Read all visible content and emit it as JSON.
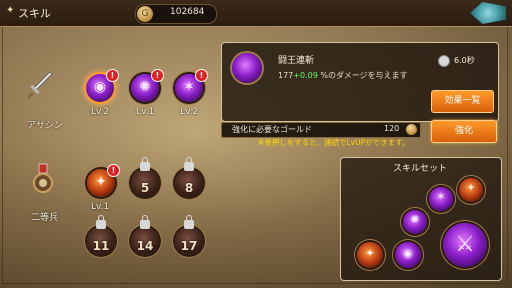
{
  "header": {
    "title": "スキル",
    "gold": "102684"
  },
  "classes": [
    {
      "label": "アサシン",
      "skills": [
        {
          "level": "Lv.2",
          "badge": "!",
          "selected": true,
          "type": "purple",
          "glyph": "◉"
        },
        {
          "level": "Lv.1",
          "badge": "!",
          "selected": false,
          "type": "purple",
          "glyph": "✺"
        },
        {
          "level": "Lv.2",
          "badge": "!",
          "selected": false,
          "type": "purple",
          "glyph": "✶"
        }
      ]
    },
    {
      "label": "二等兵",
      "skills": [
        {
          "level": "Lv.1",
          "badge": "!",
          "type": "fire",
          "glyph": "✦"
        },
        {
          "unlock": "5"
        },
        {
          "unlock": "8"
        },
        {
          "unlock": "11"
        },
        {
          "unlock": "14"
        },
        {
          "unlock": "17"
        }
      ]
    }
  ],
  "detail": {
    "name": "闘王連斬",
    "desc_base": "177",
    "desc_bonus": "+0.09",
    "desc_text": "%のダメージを与えます",
    "cooldown": "6.0秒",
    "effects_button": "効果一覧"
  },
  "enhance": {
    "label": "強化に必要なゴールド",
    "cost": "120",
    "button": "強化",
    "hint": "※長押しをすると、連続でLvUPができます。"
  },
  "skill_set": {
    "title": "スキルセット"
  },
  "colors": {
    "accent": "#ff9a2a",
    "hint": "#ffd400",
    "bonus": "#5cff5c",
    "badge": "#e02020"
  }
}
